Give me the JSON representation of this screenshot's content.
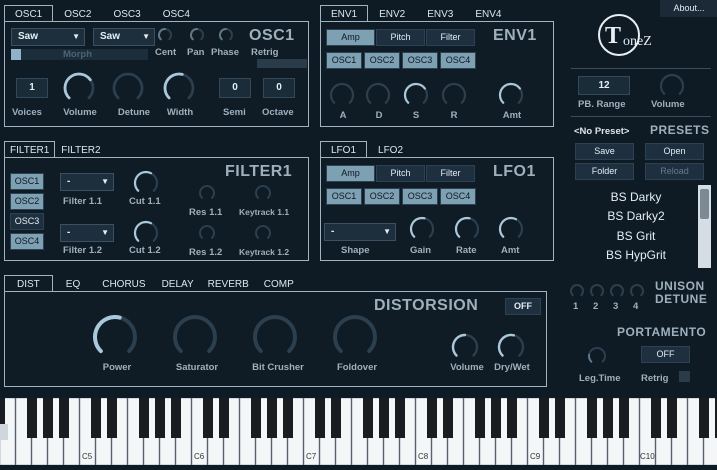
{
  "osc": {
    "tabs": [
      "OSC1",
      "OSC2",
      "OSC3",
      "OSC4"
    ],
    "title": "OSC1",
    "wave1": "Saw",
    "wave2": "Saw",
    "morph": "Morph",
    "cent": "Cent",
    "pan": "Pan",
    "phase": "Phase",
    "retrig": "Retrig",
    "voices_label": "Voices",
    "voices": "1",
    "volume": "Volume",
    "detune": "Detune",
    "width": "Width",
    "semi_label": "Semi",
    "semi": "0",
    "octave_label": "Octave",
    "octave": "0"
  },
  "env": {
    "tabs": [
      "ENV1",
      "ENV2",
      "ENV3",
      "ENV4"
    ],
    "title": "ENV1",
    "amp": "Amp",
    "pitch": "Pitch",
    "filter": "Filter",
    "targets": [
      "OSC1",
      "OSC2",
      "OSC3",
      "OSC4"
    ],
    "a": "A",
    "d": "D",
    "s": "S",
    "r": "R",
    "amt": "Amt"
  },
  "right": {
    "about": "About...",
    "logo": "ToneZ",
    "pb_value": "12",
    "pb_label": "PB. Range",
    "volume": "Volume",
    "no_preset": "<No Preset>",
    "presets": "PRESETS",
    "save": "Save",
    "open": "Open",
    "folder": "Folder",
    "reload": "Reload",
    "preset_list": [
      "BS Darky",
      "BS Darky2",
      "BS Grit",
      "BS HypGrit"
    ],
    "unison1": "UNISON",
    "unison2": "DETUNE",
    "u1": "1",
    "u2": "2",
    "u3": "3",
    "u4": "4",
    "portamento": "PORTAMENTO",
    "off": "OFF",
    "legtime": "Leg.Time",
    "retrig": "Retrig"
  },
  "filter": {
    "tabs": [
      "FILTER1",
      "FILTER2"
    ],
    "title": "FILTER1",
    "targets": [
      "OSC1",
      "OSC2",
      "OSC3",
      "OSC4"
    ],
    "dd1": "-",
    "dd2": "-",
    "f11": "Filter 1.1",
    "f12": "Filter 1.2",
    "cut11": "Cut 1.1",
    "cut12": "Cut 1.2",
    "res11": "Res 1.1",
    "res12": "Res 1.2",
    "kt11": "Keytrack 1.1",
    "kt12": "Keytrack 1.2"
  },
  "lfo": {
    "tabs": [
      "LFO1",
      "LFO2"
    ],
    "title": "LFO1",
    "amp": "Amp",
    "pitch": "Pitch",
    "filter": "Filter",
    "targets": [
      "OSC1",
      "OSC2",
      "OSC3",
      "OSC4"
    ],
    "shape_dd": "-",
    "shape": "Shape",
    "gain": "Gain",
    "rate": "Rate",
    "amt": "Amt"
  },
  "fx": {
    "tabs": [
      "DIST",
      "EQ",
      "CHORUS",
      "DELAY",
      "REVERB",
      "COMP"
    ],
    "title": "DISTORSION",
    "off": "OFF",
    "power": "Power",
    "saturator": "Saturator",
    "bitcrusher": "Bit Crusher",
    "foldover": "Foldover",
    "volume": "Volume",
    "drywet": "Dry/Wet"
  },
  "keys": {
    "labels": [
      "C5",
      "C6",
      "C7",
      "C8",
      "C9",
      "C10"
    ]
  }
}
